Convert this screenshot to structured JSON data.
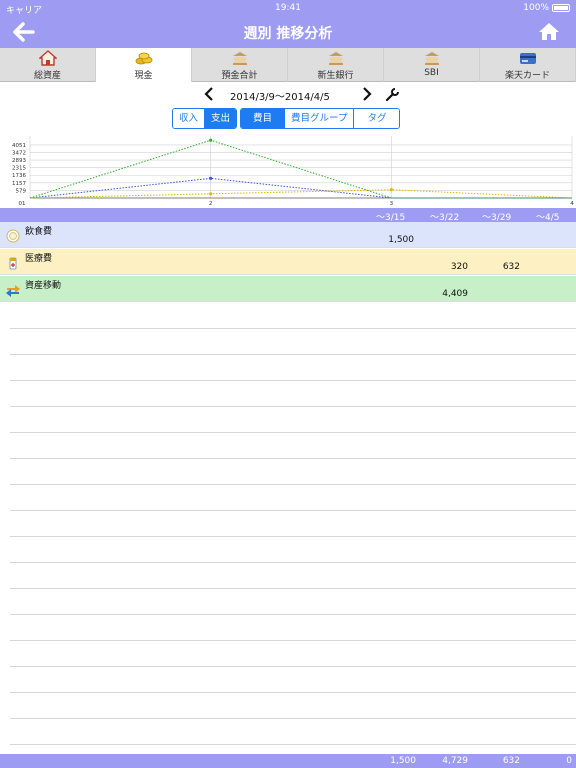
{
  "status": {
    "carrier": "キャリア",
    "time": "19:41",
    "battery": "100%"
  },
  "nav": {
    "title": "週別 推移分析"
  },
  "tabs": [
    {
      "label": "総資産",
      "icon": "house-icon",
      "active": false
    },
    {
      "label": "現金",
      "icon": "coins-icon",
      "active": true
    },
    {
      "label": "預金合計",
      "icon": "bank-icon",
      "active": false
    },
    {
      "label": "新生銀行",
      "icon": "bank-icon",
      "active": false
    },
    {
      "label": "SBI",
      "icon": "bank-icon",
      "active": false
    },
    {
      "label": "楽天カード",
      "icon": "credit-card-icon",
      "active": false
    }
  ],
  "period": {
    "range": "2014/3/9〜2014/4/5"
  },
  "type_segment": {
    "income": "収入",
    "expense": "支出",
    "selected": "expense"
  },
  "group_segment": {
    "item": "費目",
    "group": "費目グループ",
    "tag": "タグ",
    "selected": "item"
  },
  "chart_data": {
    "type": "line",
    "x": [
      1,
      2,
      3,
      4
    ],
    "x_tick_labels": [
      "01",
      "2",
      "3",
      "4"
    ],
    "y_tick_labels": [
      "579",
      "1157",
      "1736",
      "2315",
      "2893",
      "3472",
      "4051"
    ],
    "ylim": [
      0,
      4729
    ],
    "series": [
      {
        "values": [
          0,
          1500,
          0,
          0
        ],
        "color": "#3a56d6"
      },
      {
        "values": [
          0,
          320,
          632,
          0
        ],
        "color": "#e0b400"
      },
      {
        "values": [
          0,
          4409,
          0,
          0
        ],
        "color": "#2ab02a"
      }
    ],
    "grid": true
  },
  "weeks": [
    "〜3/15",
    "〜3/22",
    "〜3/29",
    "〜4/5"
  ],
  "categories": [
    {
      "name": "飲食費",
      "icon": "plate-icon",
      "bg": "#dce4fc",
      "values": [
        "1,500",
        "",
        "",
        ""
      ]
    },
    {
      "name": "医療費",
      "icon": "medicine-icon",
      "bg": "#fdf1c4",
      "values": [
        "",
        "320",
        "632",
        ""
      ]
    },
    {
      "name": "資産移動",
      "icon": "transfer-icon",
      "bg": "#c8f0c8",
      "values": [
        "",
        "4,409",
        "",
        ""
      ]
    }
  ],
  "totals": [
    "1,500",
    "4,729",
    "632",
    "0"
  ]
}
